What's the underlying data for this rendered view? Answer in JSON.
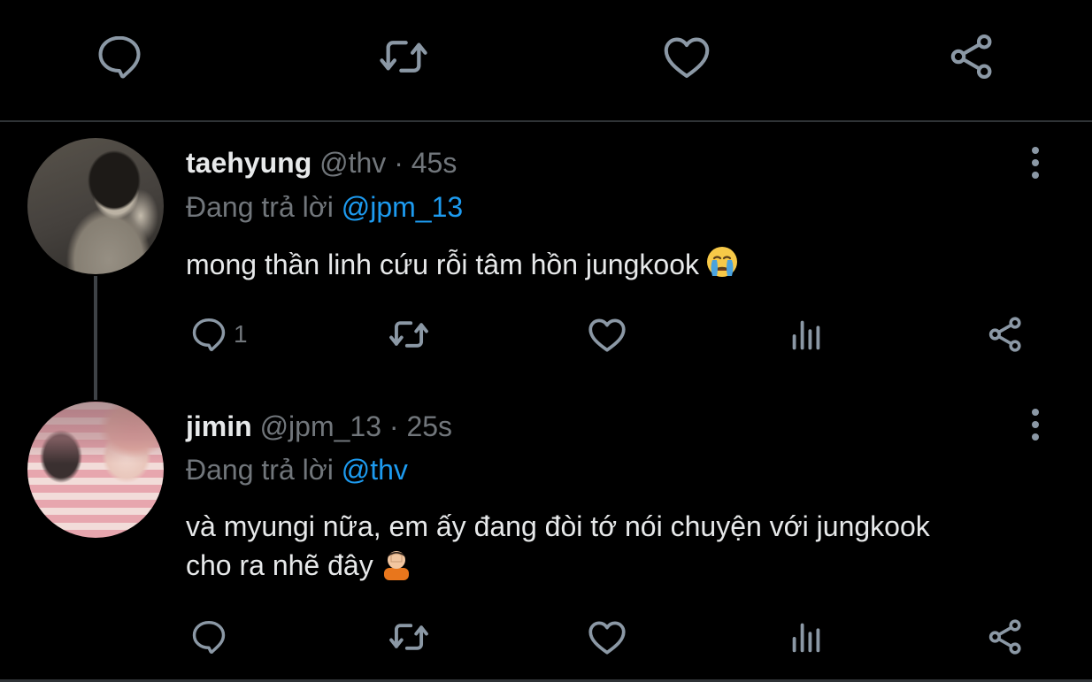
{
  "top_actions": {
    "reply_icon": "speech-bubble-icon",
    "retweet_icon": "retweet-icon",
    "like_icon": "heart-icon",
    "share_icon": "share-icon"
  },
  "tweets": [
    {
      "name": "taehyung",
      "handle": "@thv",
      "separator": "·",
      "time": "45s",
      "replying_prefix": "Đang trả lời",
      "replying_to": "@jpm_13",
      "text": "mong thần linh cứu rỗi tâm hồn jungkook",
      "emoji": "crying-face-emoji",
      "reply_count": "1"
    },
    {
      "name": "jimin",
      "handle": "@jpm_13",
      "separator": "·",
      "time": "25s",
      "replying_prefix": "Đang trả lời",
      "replying_to": "@thv",
      "text_line1": "và myungi nữa, em ấy đang đòi tớ nói chuyện với jungkook",
      "text_line2": "cho ra nhẽ đây",
      "emoji": "facepalm-emoji",
      "reply_count": ""
    }
  ],
  "colors": {
    "background": "#000000",
    "text": "#e7e9ea",
    "muted": "#71767b",
    "mention": "#1d9bf0",
    "icon": "#8b98a5",
    "divider": "#2f3336"
  }
}
